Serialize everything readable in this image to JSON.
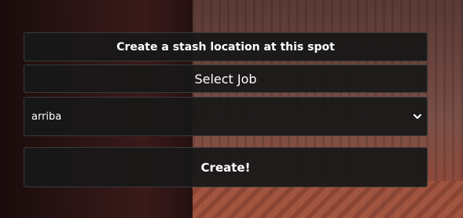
{
  "form": {
    "title": "Create a stash location at this spot",
    "job_label": "Select Job",
    "job_select": {
      "selected": "arriba",
      "icon": "chevron-down-icon"
    },
    "create_button": "Create!"
  }
}
